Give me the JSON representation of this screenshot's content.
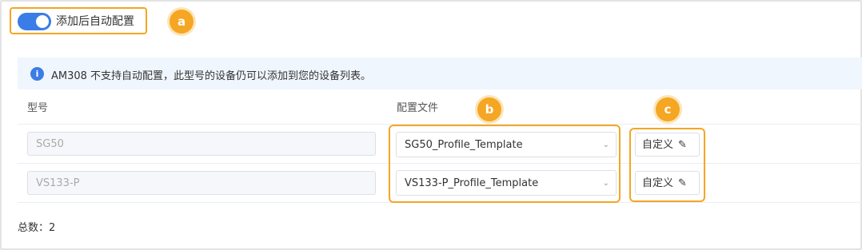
{
  "auto_config": {
    "label": "添加后自动配置",
    "enabled": true
  },
  "callouts": {
    "a": "a",
    "b": "b",
    "c": "c"
  },
  "info": {
    "icon": "info-icon",
    "glyph": "i",
    "text": "AM308 不支持自动配置，此型号的设备仍可以添加到您的设备列表。"
  },
  "table": {
    "headers": {
      "model": "型号",
      "profile": "配置文件"
    },
    "rows": [
      {
        "model": "SG50",
        "profile": "SG50_Profile_Template",
        "custom_label": "自定义"
      },
      {
        "model": "VS133-P",
        "profile": "VS133-P_Profile_Template",
        "custom_label": "自定义"
      }
    ]
  },
  "footer": {
    "total_label": "总数：",
    "total_value": "2"
  },
  "colors": {
    "accent": "#3a7de6",
    "highlight": "#f5a623"
  }
}
